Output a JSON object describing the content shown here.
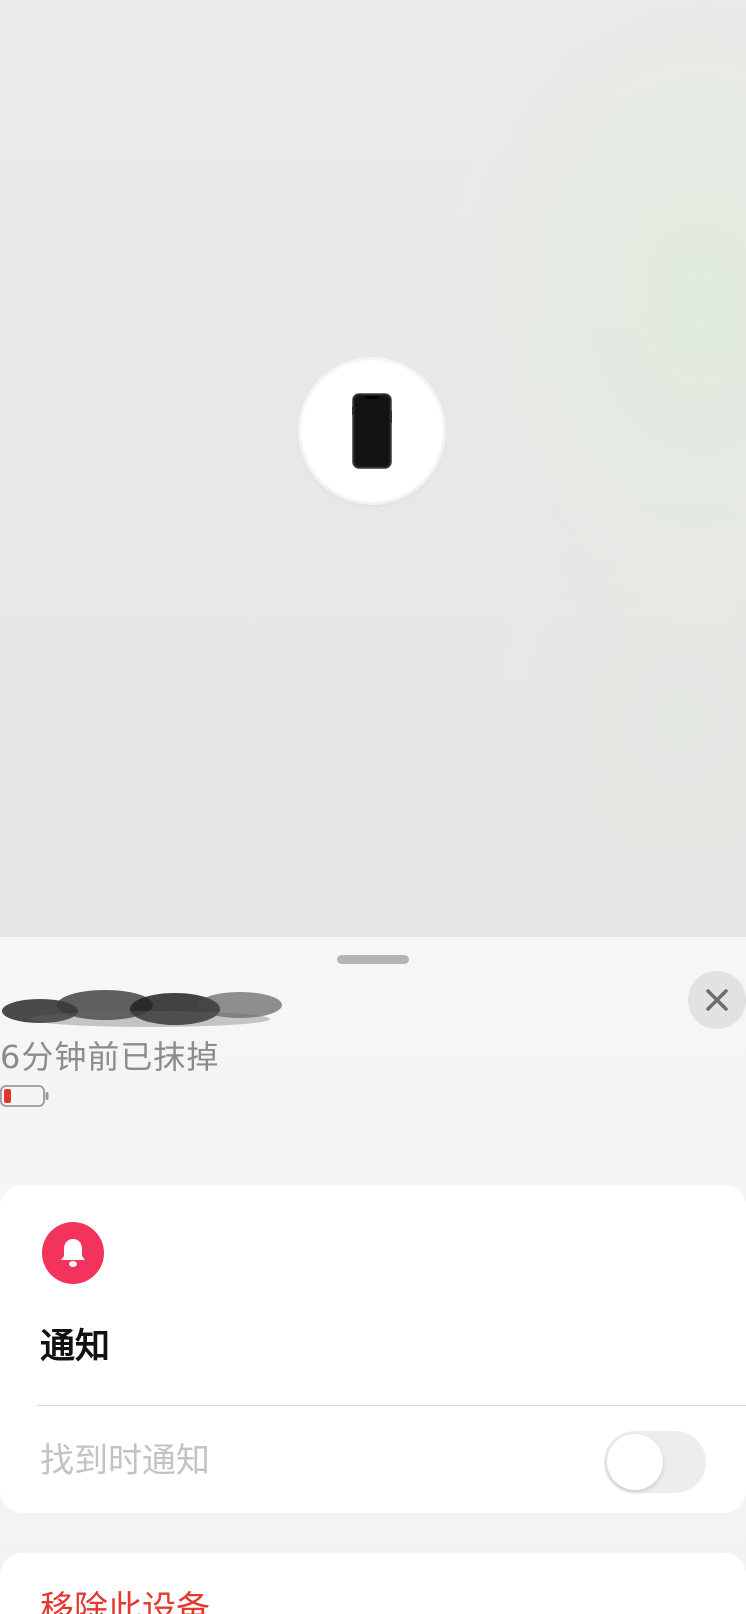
{
  "map": {
    "device_pin_icon": "iphone-device-icon"
  },
  "sheet": {
    "device_name": "",
    "status": "6分钟前已抹掉",
    "battery_level": 0.2,
    "battery_color": "#e5352b",
    "close_icon": "close-icon"
  },
  "notifications": {
    "icon": "bell-icon",
    "icon_color": "#f2345c",
    "title": "通知",
    "notify_when_found_label": "找到时通知",
    "notify_when_found_enabled": false
  },
  "remove": {
    "label": "移除此设备",
    "color": "#e33a2f"
  }
}
